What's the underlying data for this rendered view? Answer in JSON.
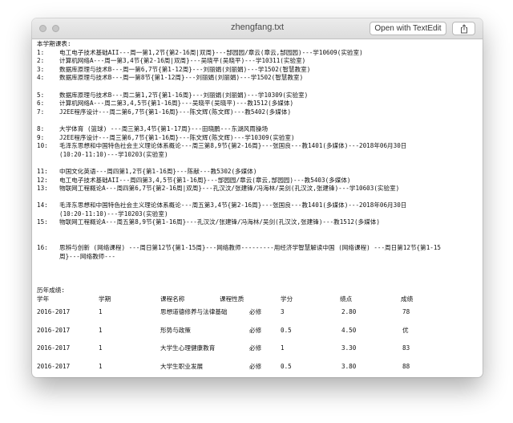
{
  "window": {
    "title": "zhengfang.txt",
    "open_button": "Open with TextEdit"
  },
  "schedule": {
    "title": "本学期课表:",
    "rows": [
      {
        "num": "1:",
        "text": "电工电子技术基础AII---周一第1,2节{第2-16周|双周}---郜园园/章云(章云,郜园园)---学10609(实验室)"
      },
      {
        "num": "2:",
        "text": "计算机网络A---周一第3,4节{第2-16周|双周}---吴晓平(吴晓平)---学10311(实验室)"
      },
      {
        "num": "3:",
        "text": "数据库原理与技术B---周一第6,7节{第1-12周}---刘丽娟(刘丽娟)---学1502(智慧教室)"
      },
      {
        "num": "4:",
        "text": "数据库原理与技术B---周一第8节{第1-12周}---刘丽娟(刘丽娟)---学1502(智慧教室)"
      },
      {
        "num": "",
        "text": ""
      },
      {
        "num": "5:",
        "text": "数据库原理与技术B---周二第1,2节{第1-16周}---刘丽娟(刘丽娟)---学10309(实验室)"
      },
      {
        "num": "6:",
        "text": "计算机网络A---周二第3,4,5节{第1-16周}---吴晓平(吴晓平)---教1512(多媒体)"
      },
      {
        "num": "7:",
        "text": "J2EE程序设计---周二第6,7节{第1-16周}---陈文辉(陈文辉)---教5402(多媒体)"
      },
      {
        "num": "",
        "text": ""
      },
      {
        "num": "8:",
        "text": "大学体育 (篮球) ---周三第3,4节{第1-17周}---田晓鹏---东湖风雨操场"
      },
      {
        "num": "9:",
        "text": "J2EE程序设计---周三第6,7节{第1-16周}---陈文辉(陈文辉)---学10309(实验室)"
      },
      {
        "num": "10:",
        "text": "毛泽东思想和中国特色社会主义理论体系概论---周三第8,9节{第2-16周}---张国良---教1401(多媒体)---2018年06月30日"
      },
      {
        "num": "",
        "text": "(10:20-11:10)---学10203(实验室)"
      },
      {
        "num": "",
        "text": ""
      },
      {
        "num": "11:",
        "text": "中国文化英语---周四第1,2节{第1-16周}---陈献---教5302(多媒体)"
      },
      {
        "num": "12:",
        "text": "电工电子技术基础AII---周四第3,4,5节{第1-16周}---郜园园/章云(章云,郜园园)---教5403(多媒体)"
      },
      {
        "num": "13:",
        "text": "物联网工程概论A---周四第6,7节{第2-16周|双周}---孔汉汶/张建锋/冯海林/吴剑(孔汉汶,张建锋)---学10603(实验室)"
      },
      {
        "num": "",
        "text": ""
      },
      {
        "num": "14:",
        "text": "毛泽东思想和中国特色社会主义理论体系概论---周五第3,4节{第2-16周}---张国良---教1401(多媒体)---2018年06月30日"
      },
      {
        "num": "",
        "text": "(10:20-11:10)---学10203(实验室)"
      },
      {
        "num": "15:",
        "text": "物联网工程概论A---周五第8,9节{第1-16周}---孔汉汶/张建锋/冯海林/吴剑(孔汉汶,张建锋)---教1512(多媒体)"
      },
      {
        "num": "",
        "text": ""
      },
      {
        "num": "",
        "text": ""
      },
      {
        "num": "16:",
        "text": "思辨与创新 (网络课程) ---周日第12节{第1-15周}---网络教师---------用经济学智慧解读中国 (网络课程) ---周日第12节{第1-15"
      },
      {
        "num": "",
        "text": "周}---网络教师---"
      }
    ]
  },
  "grades": {
    "title": "历年成绩:",
    "headers": {
      "year": "学年",
      "term": "学期",
      "course": "课程名称",
      "type": "课程性质",
      "credit": "学分",
      "point": "绩点",
      "score": "成绩"
    },
    "rows": [
      {
        "year": "2016-2017",
        "term": "1",
        "course": "思想道德修养与法律基础",
        "type": "必修",
        "credit": "3",
        "point": "2.80",
        "score": "78"
      },
      {
        "year": "2016-2017",
        "term": "1",
        "course": "形势与政策",
        "type": "必修",
        "credit": "0.5",
        "point": "4.50",
        "score": "优"
      },
      {
        "year": "2016-2017",
        "term": "1",
        "course": "大学生心理健康教育",
        "type": "必修",
        "credit": "1",
        "point": "3.30",
        "score": "83"
      },
      {
        "year": "2016-2017",
        "term": "1",
        "course": "大学生职业发展",
        "type": "必修",
        "credit": "0.5",
        "point": "3.80",
        "score": "88"
      }
    ]
  }
}
